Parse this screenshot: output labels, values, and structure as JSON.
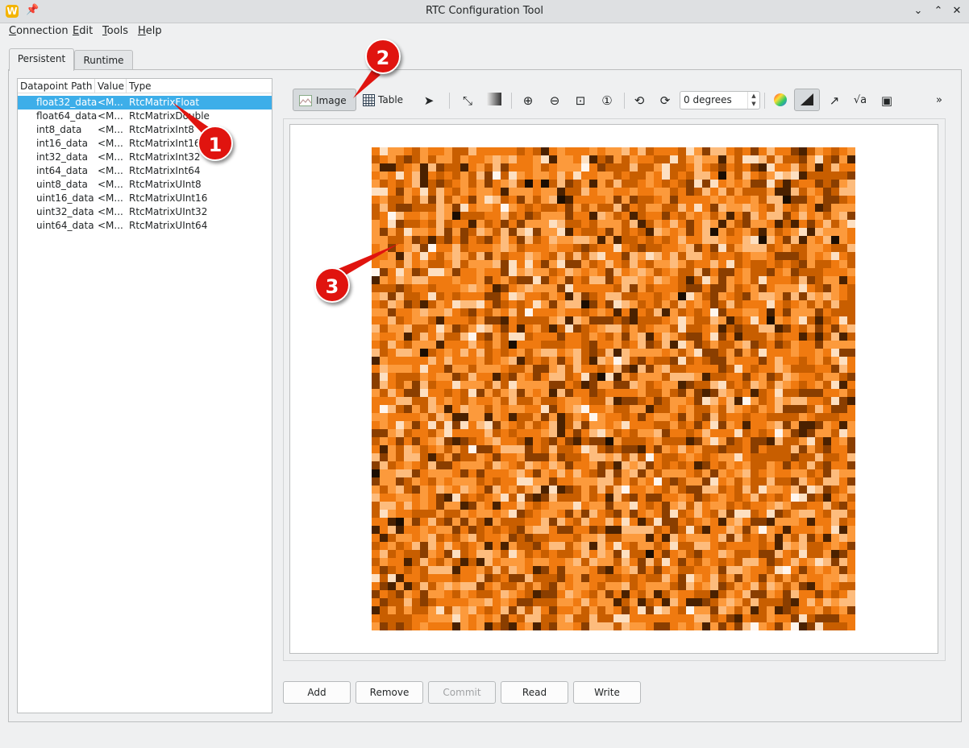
{
  "window": {
    "title": "RTC Configuration Tool",
    "logo_letter": "W",
    "pin_icon": "pin-icon",
    "controls": [
      "chevron-down-icon",
      "chevron-up-icon",
      "close-icon"
    ]
  },
  "menu": {
    "connection": "Connection",
    "edit": "Edit",
    "tools": "Tools",
    "help": "Help"
  },
  "tabs": {
    "persistent": "Persistent",
    "runtime": "Runtime"
  },
  "tree": {
    "headers": {
      "path": "Datapoint Path",
      "value": "Value",
      "type": "Type"
    },
    "rows": [
      {
        "path": "float32_data",
        "value": "<M...",
        "type": "RtcMatrixFloat",
        "selected": true
      },
      {
        "path": "float64_data",
        "value": "<M...",
        "type": "RtcMatrixDouble"
      },
      {
        "path": "int8_data",
        "value": "<M...",
        "type": "RtcMatrixInt8"
      },
      {
        "path": "int16_data",
        "value": "<M...",
        "type": "RtcMatrixInt16"
      },
      {
        "path": "int32_data",
        "value": "<M...",
        "type": "RtcMatrixInt32"
      },
      {
        "path": "int64_data",
        "value": "<M...",
        "type": "RtcMatrixInt64"
      },
      {
        "path": "uint8_data",
        "value": "<M...",
        "type": "RtcMatrixUInt8"
      },
      {
        "path": "uint16_data",
        "value": "<M...",
        "type": "RtcMatrixUInt16"
      },
      {
        "path": "uint32_data",
        "value": "<M...",
        "type": "RtcMatrixUInt32"
      },
      {
        "path": "uint64_data",
        "value": "<M...",
        "type": "RtcMatrixUInt64"
      }
    ]
  },
  "toolbar": {
    "image_label": "Image",
    "table_label": "Table",
    "angle_value": "0 degrees",
    "more": "»",
    "icons": [
      "image-icon",
      "table-icon",
      "pointer-icon",
      "line-profile-icon",
      "gradient-icon",
      "zoom-in-icon",
      "zoom-out-icon",
      "zoom-fit-icon",
      "zoom-original-icon",
      "rotate-left-icon",
      "rotate-right-icon",
      "colormap-icon",
      "contrast-icon",
      "scale-icon",
      "sqrt-icon",
      "image-settings-icon"
    ]
  },
  "image": {
    "colormap": "orange-heat",
    "palette": [
      "#1a0d02",
      "#4a2100",
      "#8a3e00",
      "#c85e00",
      "#f07a10",
      "#fc9a3c",
      "#fdbc7d",
      "#fde0c2",
      "#fff6ee"
    ],
    "rows": 60,
    "cols": 60
  },
  "buttons": {
    "add": "Add",
    "remove": "Remove",
    "commit": "Commit",
    "read": "Read",
    "write": "Write"
  },
  "callouts": [
    "1",
    "2",
    "3"
  ]
}
